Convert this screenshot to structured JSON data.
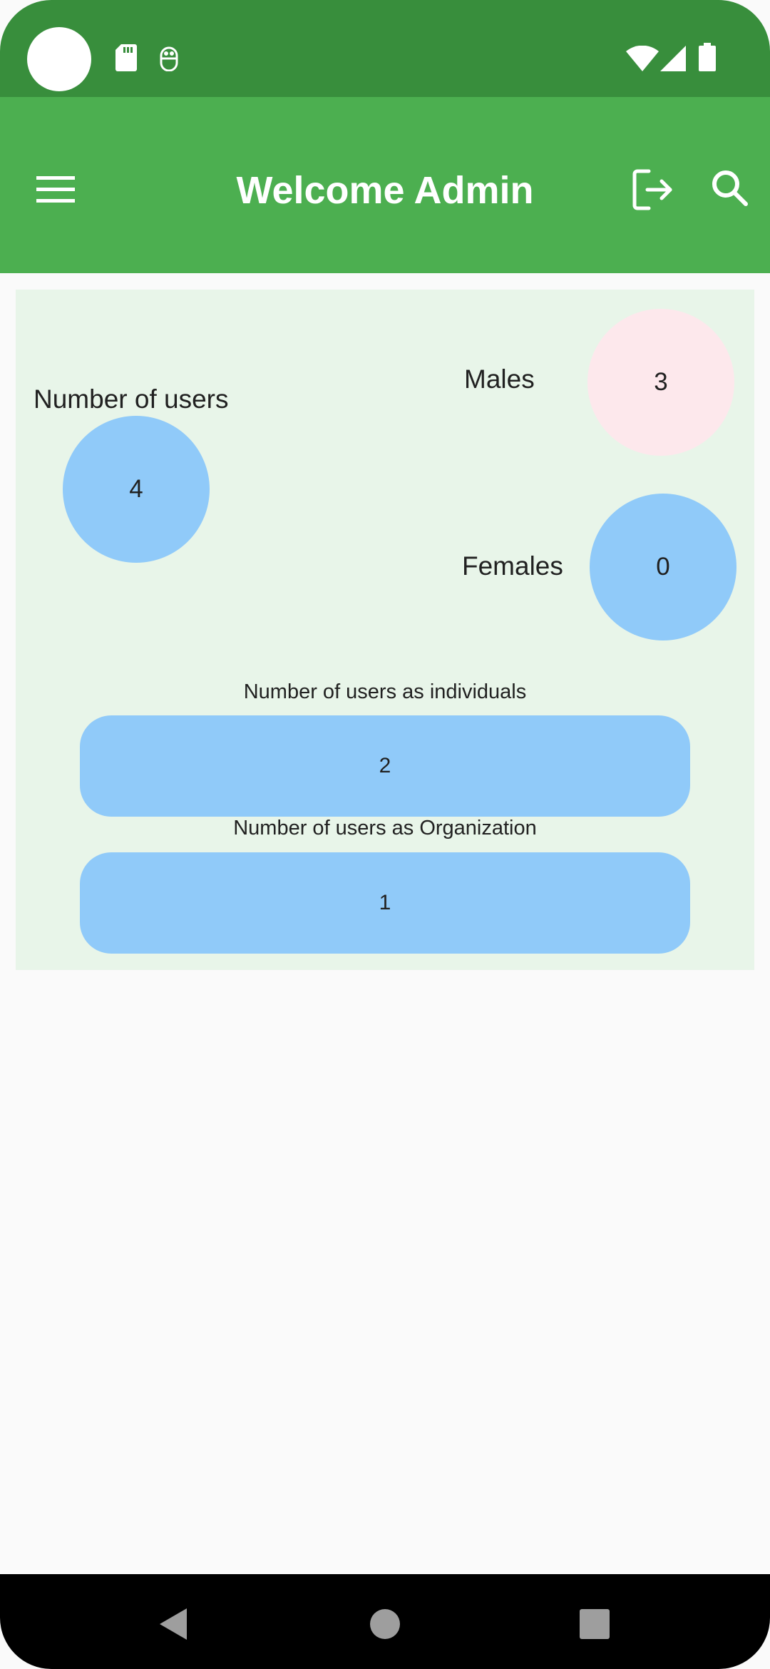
{
  "app_bar": {
    "title": "Welcome Admin"
  },
  "stats": {
    "total_users_label": "Number of users",
    "total_users": "4",
    "males_label": "Males",
    "males": "3",
    "females_label": "Females",
    "females": "0",
    "individuals_label": "Number of users as individuals",
    "individuals": "2",
    "organization_label": "Number of users as Organization",
    "organization": "1"
  },
  "colors": {
    "status_bar": "#388e3c",
    "app_bar": "#4caf50",
    "panel": "#e8f5e9",
    "blue_circle": "#90caf9",
    "pink_circle": "#fde8ec"
  }
}
